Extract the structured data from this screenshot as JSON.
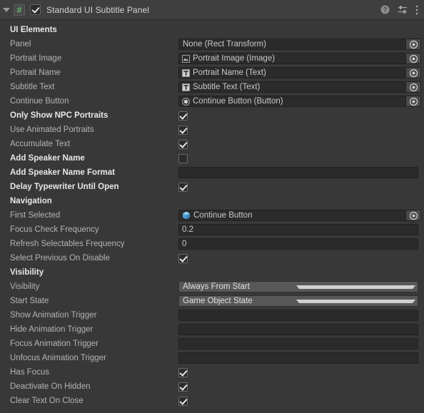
{
  "header": {
    "foldout_icon": "triangle-down-icon",
    "script_icon": "cs-script-icon",
    "script_icon_glyph": "#",
    "enabled": true,
    "title": "Standard UI Subtitle Panel",
    "help_icon": "help-icon",
    "preset_icon": "preset-sliders-icon",
    "menu_icon": "kebab-menu-icon"
  },
  "sections": [
    {
      "title": "UI Elements",
      "rows": [
        {
          "label": "Panel",
          "override": false,
          "type": "object",
          "value": "None (Rect Transform)",
          "icon": "none"
        },
        {
          "label": "Portrait Image",
          "override": false,
          "type": "object",
          "value": "Portrait Image (Image)",
          "icon": "image-icon"
        },
        {
          "label": "Portrait Name",
          "override": false,
          "type": "object",
          "value": "Portrait Name (Text)",
          "icon": "text-icon"
        },
        {
          "label": "Subtitle Text",
          "override": false,
          "type": "object",
          "value": "Subtitle Text (Text)",
          "icon": "text-icon"
        },
        {
          "label": "Continue Button",
          "override": false,
          "type": "object",
          "value": "Continue Button (Button)",
          "icon": "button-icon"
        },
        {
          "label": "Only Show NPC Portraits",
          "override": true,
          "type": "checkbox",
          "value": true
        },
        {
          "label": "Use Animated Portraits",
          "override": false,
          "type": "checkbox",
          "value": true
        },
        {
          "label": "Accumulate Text",
          "override": false,
          "type": "checkbox",
          "value": true
        },
        {
          "label": "Add Speaker Name",
          "override": true,
          "type": "checkbox",
          "value": false
        },
        {
          "label": "Add Speaker Name Format",
          "override": true,
          "type": "text",
          "value": "",
          "placeholder": ""
        },
        {
          "label": "Delay Typewriter Until Open",
          "override": true,
          "type": "checkbox",
          "value": true
        }
      ]
    },
    {
      "title": "Navigation",
      "rows": [
        {
          "label": "First Selected",
          "override": false,
          "type": "object",
          "value": "Continue Button",
          "icon": "gameobject-cube-icon"
        },
        {
          "label": "Focus Check Frequency",
          "override": false,
          "type": "text",
          "value": "0.2",
          "placeholder": ""
        },
        {
          "label": "Refresh Selectables Frequency",
          "override": false,
          "type": "text",
          "value": "0",
          "placeholder": ""
        },
        {
          "label": "Select Previous On Disable",
          "override": false,
          "type": "checkbox",
          "value": true
        }
      ]
    },
    {
      "title": "Visibility",
      "rows": [
        {
          "label": "Visibility",
          "override": false,
          "type": "dropdown",
          "value": "Always From Start"
        },
        {
          "label": "Start State",
          "override": false,
          "type": "dropdown",
          "value": "Game Object State"
        },
        {
          "label": "Show Animation Trigger",
          "override": false,
          "type": "text",
          "value": "",
          "placeholder": ""
        },
        {
          "label": "Hide Animation Trigger",
          "override": false,
          "type": "text",
          "value": "",
          "placeholder": ""
        },
        {
          "label": "Focus Animation Trigger",
          "override": false,
          "type": "text",
          "value": "",
          "placeholder": ""
        },
        {
          "label": "Unfocus Animation Trigger",
          "override": false,
          "type": "text",
          "value": "",
          "placeholder": ""
        },
        {
          "label": "Has Focus",
          "override": false,
          "type": "checkbox",
          "value": true
        },
        {
          "label": "Deactivate On Hidden",
          "override": false,
          "type": "checkbox",
          "value": true
        },
        {
          "label": "Clear Text On Close",
          "override": false,
          "type": "checkbox",
          "value": true
        }
      ]
    }
  ],
  "colors": {
    "background": "#383838",
    "header_background": "#3f3f3f",
    "field_background": "#2b2b2b",
    "dropdown_background": "#585858",
    "label": "#b4b4b4",
    "override_label": "#e8e8e8",
    "script_icon_green": "#63c06a",
    "gameobject_blue": "#5aa9dd"
  }
}
